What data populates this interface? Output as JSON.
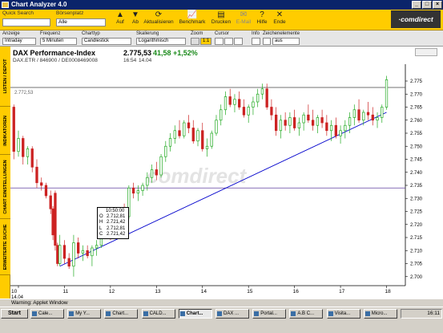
{
  "window": {
    "title": "Chart Analyzer 4.0",
    "controls": [
      "_",
      "□",
      "×"
    ]
  },
  "toolbar": {
    "quick_search_label": "Quick Search",
    "quick_search_value": "",
    "board_label": "Börsenplatz",
    "board_value": "Alle",
    "buy_label": "Auf",
    "sell_label": "Ab",
    "refresh_label": "Aktualisieren",
    "benchmark_label": "Benchmark",
    "print_label": "Drucken",
    "email_label": "E-Mail",
    "help_label": "Hilfe",
    "exit_label": "Ende",
    "brand": "·comdirect"
  },
  "options": {
    "range_label": "Anzeige",
    "range_value": "Intraday",
    "freq_label": "Frequenz",
    "freq_value": "5 Minuten",
    "type_label": "Charttyp",
    "type_value": "Candlestick",
    "scale_label": "Skalierung",
    "scale_value": "Logarithmisch",
    "zoom_label": "Zoom",
    "zoom_value": "1:1",
    "cursor_label": "Cursor",
    "info_label": "Info",
    "drawing_label": "Zeichenelemente",
    "drawing_value": "aus"
  },
  "sidebar": {
    "tabs": [
      "LISTEN / DEPOT",
      "INDIKATOREN",
      "CHART EINSTELLUNGEN",
      "ERWEITERTE SUCHE"
    ]
  },
  "chart": {
    "title": "DAX Performance-Index",
    "subtitle": "DAX.ETR / 846900 / DE0008469008",
    "price": "2.775,53",
    "change": "41,58",
    "change_pct": "+1,52%",
    "time": "16:54",
    "date": "14.04",
    "ref_label": "2.772,53",
    "watermark": "comdirect",
    "tooltip": {
      "time": "10:50:00",
      "rows": [
        {
          "k": "O",
          "v": "2.712,81"
        },
        {
          "k": "H",
          "v": "2.721,42"
        },
        {
          "k": "L",
          "v": "2.712,81"
        },
        {
          "k": "C",
          "v": "2.721,42"
        }
      ]
    }
  },
  "chart_data": {
    "type": "candlestick",
    "x_day_ticks": [
      "10",
      "11",
      "12",
      "13",
      "14",
      "15",
      "16",
      "17",
      "18"
    ],
    "x_first_sub": "14.04",
    "y_ticks": [
      "2.700",
      "2.705",
      "2.710",
      "2.715",
      "2.720",
      "2.725",
      "2.730",
      "2.735",
      "2.740",
      "2.745",
      "2.750",
      "2.755",
      "2.760",
      "2.765",
      "2.770",
      "2.775"
    ],
    "ylim": [
      2699,
      2779
    ],
    "reference_lines": [
      {
        "value": 2772.53,
        "label": "2.772,53",
        "color": "#444444"
      },
      {
        "value": 2734,
        "color": "#6040a0"
      }
    ],
    "trendline": {
      "from": {
        "hour": 10.9,
        "value": 2704
      },
      "to": {
        "hour": 18.0,
        "value": 2763
      },
      "color": "#0000cc"
    },
    "up_color": "#22aa22",
    "down_color": "#cc2222",
    "candles": [
      [
        9.9,
        2765,
        2766,
        2745,
        2748
      ],
      [
        10,
        2748,
        2756,
        2746,
        2753
      ],
      [
        10.1,
        2753,
        2754,
        2743,
        2746
      ],
      [
        10.2,
        2746,
        2750,
        2743,
        2749
      ],
      [
        10.3,
        2749,
        2750,
        2740,
        2742
      ],
      [
        10.4,
        2742,
        2745,
        2734,
        2736
      ],
      [
        10.5,
        2736,
        2738,
        2733,
        2735
      ],
      [
        10.6,
        2735,
        2736,
        2730,
        2731
      ],
      [
        10.7,
        2731,
        2733,
        2724,
        2726
      ],
      [
        10.75,
        2726,
        2727,
        2714,
        2716
      ],
      [
        10.8,
        2732,
        2733,
        2710,
        2712
      ],
      [
        10.85,
        2712,
        2713,
        2704,
        2705
      ],
      [
        10.9,
        2705,
        2716,
        2704,
        2712
      ],
      [
        11,
        2712,
        2714,
        2705,
        2707
      ],
      [
        11.1,
        2707,
        2709,
        2703,
        2704
      ],
      [
        11.2,
        2704,
        2716,
        2700,
        2713
      ],
      [
        11.3,
        2713,
        2715,
        2707,
        2709
      ],
      [
        11.4,
        2709,
        2712,
        2706,
        2710
      ],
      [
        11.5,
        2710,
        2712,
        2707,
        2708
      ],
      [
        11.6,
        2708,
        2712,
        2704,
        2711
      ],
      [
        11.7,
        2711,
        2714,
        2708,
        2712
      ],
      [
        11.8,
        2712,
        2722,
        2711,
        2720
      ],
      [
        11.9,
        2718,
        2725,
        2716,
        2721
      ],
      [
        12,
        2721,
        2722,
        2714,
        2716
      ],
      [
        12.1,
        2716,
        2720,
        2715,
        2719
      ],
      [
        12.2,
        2719,
        2726,
        2718,
        2725
      ],
      [
        12.3,
        2725,
        2728,
        2722,
        2723
      ],
      [
        12.4,
        2723,
        2735,
        2722,
        2734
      ],
      [
        12.5,
        2734,
        2736,
        2730,
        2732
      ],
      [
        12.6,
        2732,
        2735,
        2729,
        2733
      ],
      [
        12.7,
        2733,
        2736,
        2731,
        2735
      ],
      [
        12.8,
        2735,
        2740,
        2733,
        2738
      ],
      [
        12.9,
        2738,
        2743,
        2736,
        2741
      ],
      [
        13,
        2741,
        2744,
        2737,
        2739
      ],
      [
        13.1,
        2739,
        2747,
        2738,
        2746
      ],
      [
        13.2,
        2746,
        2752,
        2744,
        2750
      ],
      [
        13.3,
        2750,
        2755,
        2748,
        2753
      ],
      [
        13.4,
        2753,
        2758,
        2751,
        2756
      ],
      [
        13.5,
        2756,
        2760,
        2753,
        2754
      ],
      [
        13.6,
        2754,
        2760,
        2753,
        2759
      ],
      [
        13.7,
        2759,
        2762,
        2755,
        2757
      ],
      [
        13.8,
        2757,
        2760,
        2751,
        2752
      ],
      [
        13.9,
        2752,
        2757,
        2750,
        2756
      ],
      [
        14,
        2756,
        2759,
        2748,
        2749
      ],
      [
        14.1,
        2749,
        2753,
        2746,
        2750
      ],
      [
        14.2,
        2750,
        2756,
        2749,
        2755
      ],
      [
        14.3,
        2755,
        2762,
        2754,
        2760
      ],
      [
        14.4,
        2760,
        2766,
        2758,
        2764
      ],
      [
        14.5,
        2764,
        2771,
        2762,
        2769
      ],
      [
        14.6,
        2769,
        2772,
        2765,
        2766
      ],
      [
        14.7,
        2766,
        2770,
        2763,
        2768
      ],
      [
        14.8,
        2768,
        2771,
        2764,
        2765
      ],
      [
        14.9,
        2765,
        2768,
        2761,
        2762
      ],
      [
        15,
        2762,
        2766,
        2759,
        2765
      ],
      [
        15.1,
        2765,
        2769,
        2762,
        2767
      ],
      [
        15.2,
        2767,
        2772,
        2765,
        2770
      ],
      [
        15.3,
        2770,
        2774,
        2768,
        2772
      ],
      [
        15.4,
        2772,
        2774,
        2764,
        2765
      ],
      [
        15.5,
        2765,
        2768,
        2760,
        2762
      ],
      [
        15.6,
        2762,
        2765,
        2754,
        2756
      ],
      [
        15.7,
        2756,
        2762,
        2753,
        2760
      ],
      [
        15.8,
        2760,
        2763,
        2756,
        2758
      ],
      [
        15.9,
        2758,
        2763,
        2755,
        2761
      ],
      [
        16,
        2761,
        2764,
        2756,
        2757
      ],
      [
        16.1,
        2757,
        2761,
        2754,
        2759
      ],
      [
        16.2,
        2759,
        2763,
        2756,
        2762
      ],
      [
        16.3,
        2762,
        2766,
        2759,
        2760
      ],
      [
        16.4,
        2760,
        2764,
        2756,
        2758
      ],
      [
        16.5,
        2758,
        2762,
        2755,
        2761
      ],
      [
        16.6,
        2761,
        2764,
        2757,
        2759
      ],
      [
        16.7,
        2759,
        2762,
        2754,
        2756
      ],
      [
        16.8,
        2756,
        2760,
        2752,
        2758
      ],
      [
        16.9,
        2758,
        2761,
        2753,
        2754
      ],
      [
        17,
        2754,
        2758,
        2751,
        2756
      ],
      [
        17.1,
        2756,
        2760,
        2753,
        2758
      ],
      [
        17.2,
        2758,
        2763,
        2755,
        2761
      ],
      [
        17.3,
        2761,
        2766,
        2758,
        2764
      ],
      [
        17.4,
        2764,
        2768,
        2759,
        2760
      ],
      [
        17.5,
        2760,
        2764,
        2758,
        2763
      ],
      [
        17.6,
        2763,
        2767,
        2760,
        2762
      ],
      [
        17.7,
        2762,
        2765,
        2758,
        2760
      ],
      [
        17.8,
        2760,
        2763,
        2757,
        2761
      ],
      [
        17.9,
        2761,
        2766,
        2759,
        2765
      ],
      [
        18,
        2765,
        2777,
        2764,
        2775.5
      ]
    ]
  },
  "status": {
    "text": "Warning: Applet Window"
  },
  "taskbar": {
    "start_label": "Start",
    "tasks": [
      "Cale...",
      "My Y...",
      "Chart...",
      "CALD...",
      "Chart...",
      "DAX ...",
      "Portal...",
      "A.B C...",
      "Visita...",
      "Micro..."
    ],
    "active_index": 4,
    "clock": "16:11"
  }
}
